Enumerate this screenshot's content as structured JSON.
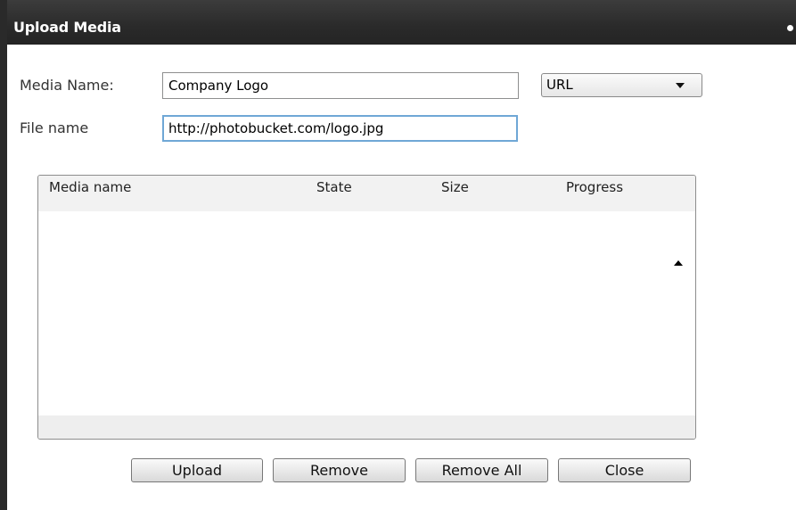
{
  "dialog": {
    "title": "Upload Media"
  },
  "form": {
    "media_name_label": "Media Name:",
    "media_name_value": "Company Logo",
    "file_name_label": "File name",
    "file_name_value": "http://photobucket.com/logo.jpg",
    "source_select_value": "URL"
  },
  "grid": {
    "columns": [
      "Media name",
      "State",
      "Size",
      "Progress"
    ],
    "rows": []
  },
  "buttons": {
    "upload": "Upload",
    "remove": "Remove",
    "remove_all": "Remove All",
    "close": "Close"
  }
}
